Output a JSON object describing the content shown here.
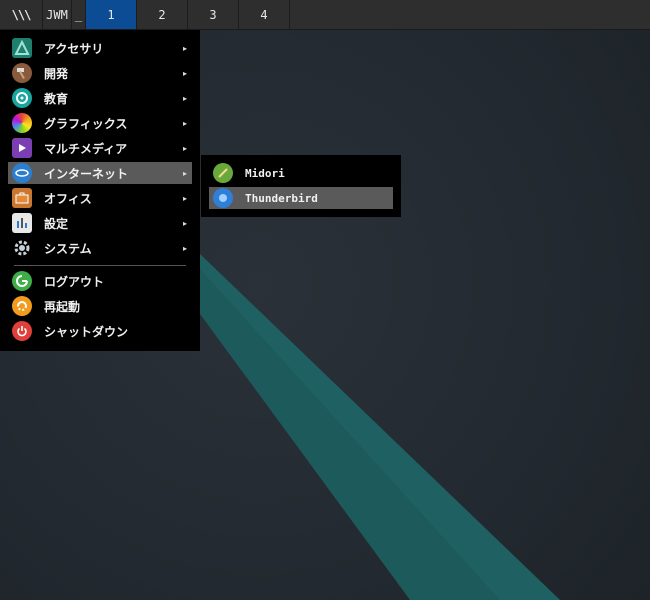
{
  "taskbar": {
    "logo": "\\\\\\",
    "jwm_label": "JWM",
    "minimize_label": "_",
    "workspaces": [
      "1",
      "2",
      "3",
      "4"
    ],
    "active_workspace": "1",
    "active_color": "#0b4c94"
  },
  "main_menu": {
    "items": [
      {
        "label": "アクセサリ",
        "icon": "accessories-icon",
        "has_submenu": true
      },
      {
        "label": "開発",
        "icon": "hammer-icon",
        "has_submenu": true
      },
      {
        "label": "教育",
        "icon": "education-icon",
        "has_submenu": true
      },
      {
        "label": "グラフィックス",
        "icon": "graphics-icon",
        "has_submenu": true
      },
      {
        "label": "マルチメディア",
        "icon": "multimedia-icon",
        "has_submenu": true
      },
      {
        "label": "インターネット",
        "icon": "internet-icon",
        "has_submenu": true,
        "highlighted": true
      },
      {
        "label": "オフィス",
        "icon": "briefcase-icon",
        "has_submenu": true
      },
      {
        "label": "設定",
        "icon": "settings-icon",
        "has_submenu": true
      },
      {
        "label": "システム",
        "icon": "gear-icon",
        "has_submenu": true
      }
    ],
    "actions": [
      {
        "label": "ログアウト",
        "icon": "logout-icon"
      },
      {
        "label": "再起動",
        "icon": "restart-icon"
      },
      {
        "label": "シャットダウン",
        "icon": "shutdown-icon"
      }
    ],
    "arrow_glyph": "▸"
  },
  "internet_submenu": {
    "items": [
      {
        "label": "Midori",
        "icon": "midori-icon"
      },
      {
        "label": "Thunderbird",
        "icon": "thunderbird-icon",
        "highlighted": true
      }
    ]
  },
  "colors": {
    "menu_bg": "#000000",
    "highlight": "#5a5a5a",
    "desktop_stripe": "#1d5a5c"
  }
}
